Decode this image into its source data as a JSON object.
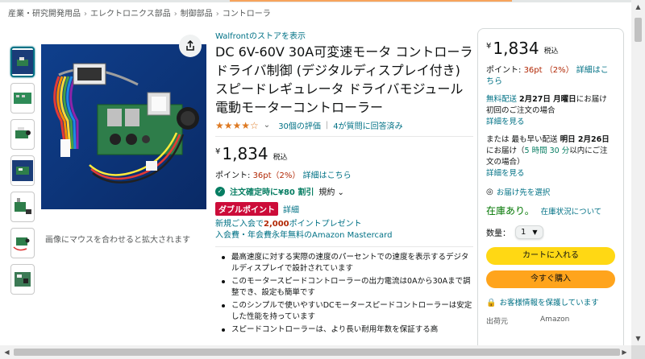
{
  "breadcrumb": {
    "items": [
      "産業・研究開発用品",
      "エレクトロニクス部品",
      "制御部品",
      "コントローラ"
    ],
    "separator": "›"
  },
  "gallery": {
    "thumbnails": [
      "thumb-1",
      "thumb-2",
      "thumb-3",
      "thumb-4",
      "thumb-5",
      "thumb-6",
      "thumb-7"
    ],
    "zoom_hint": "画像にマウスを合わせると拡大されます"
  },
  "product": {
    "store_link": "Walfrontのストアを表示",
    "title": "DC 6V-60V 30A可変速モータ コントローラ ドライバ制御 (デジタルディスプレイ付き) スピードレギュレータ ドライバモジュール 電動モーターコントローラー",
    "rating": {
      "stars_value": 4.0,
      "stars_display": "★★★★☆",
      "reviews": "30個の評価",
      "qa": "4が質問に回答済み"
    },
    "price": {
      "symbol": "¥",
      "amount": "1,834",
      "tax": "税込"
    },
    "points": {
      "label": "ポイント:",
      "value": "36pt（2%）",
      "link": "詳細はこちら"
    },
    "coupon": {
      "text": "注文確定時に¥80 割引",
      "terms": "規約"
    },
    "double_points": {
      "badge": "ダブルポイント",
      "link": "詳細"
    },
    "mastercard": {
      "line1_prefix": "新規ご入会で",
      "line1_bold": "2,000",
      "line1_suffix": "ポイントプレゼント",
      "line2": "入会費・年会費永年無料のAmazon Mastercard"
    },
    "bullets": [
      "最高速度に対する実際の速度のパーセントでの速度を表示するデジタルディスプレイで設計されています",
      "このモータースピードコントローラーの出力電流は0Aから30Aまで調整でき、設定も簡単です",
      "このシンプルで使いやすいDCモータースピードコントローラーは安定した性能を持っています",
      "スピードコントローラーは、より長い耐用年数を保証する高"
    ]
  },
  "buybox": {
    "price": {
      "symbol": "¥",
      "amount": "1,834",
      "tax": "税込"
    },
    "points": {
      "label": "ポイント:",
      "value": "36pt （2%）",
      "link": "詳細はこちら"
    },
    "free_delivery": {
      "link": "無料配送",
      "date": "2月27日 月曜日",
      "text": "にお届け　初回のご注文の場合",
      "details": "詳細を見る"
    },
    "fastest": {
      "prefix": "または 最も早い配送",
      "date": "明日 2月26日",
      "text1": "にお届け（",
      "countdown": "5 時間 30 分",
      "text2": "以内にご注文の場合）",
      "details": "詳細を見る"
    },
    "location": "お届け先を選択",
    "stock": "在庫あり。",
    "stock_link": "在庫状況について",
    "quantity": {
      "label": "数量：",
      "value": "1"
    },
    "add_to_cart": "カートに入れる",
    "buy_now": "今すぐ購入",
    "secure": "お客様情報を保護しています",
    "bottom": {
      "left": "出荷元",
      "right": "Amazon"
    }
  },
  "colors": {
    "link": "#007185",
    "price_red": "#b12704",
    "cart_yellow": "#ffd814",
    "buy_orange": "#ffa41c",
    "badge_red": "#cc0c39",
    "stock_green": "#007600",
    "star_orange": "#de7921"
  }
}
